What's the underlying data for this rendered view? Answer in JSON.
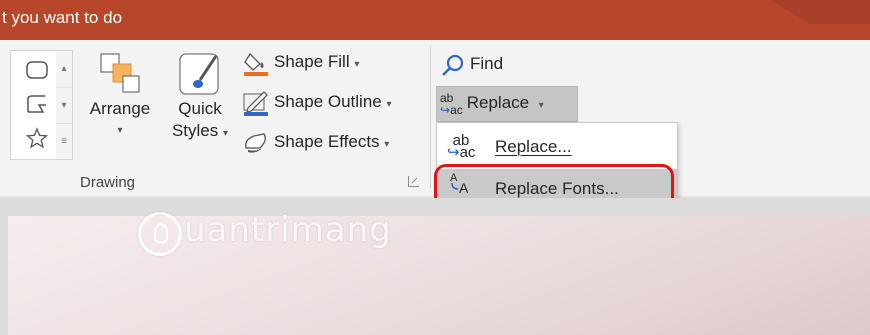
{
  "titlebar": {
    "tell_me_text": "t you want to do"
  },
  "drawing": {
    "group_label": "Drawing",
    "arrange_label": "Arrange",
    "quick_styles_label_line1": "Quick",
    "quick_styles_label_line2": "Styles",
    "shape_fill_label": "Shape Fill",
    "shape_outline_label": "Shape Outline",
    "shape_effects_label": "Shape Effects",
    "dropdown_glyph": "▾"
  },
  "editing": {
    "find_label": "Find",
    "replace_label": "Replace",
    "replace_icon_text": "ab ac",
    "menu": [
      {
        "label": "Replace...",
        "icon": "replace-icon"
      },
      {
        "label": "Replace Fonts...",
        "icon": "replace-fonts-icon"
      }
    ]
  },
  "watermark": {
    "text": "uantrimang"
  },
  "colors": {
    "title_bar": "#b7472a",
    "ribbon": "#f3f3f3",
    "highlight": "#e0121b",
    "shape_fill_accent": "#e9701d",
    "shape_outline_accent": "#2f67c9"
  }
}
